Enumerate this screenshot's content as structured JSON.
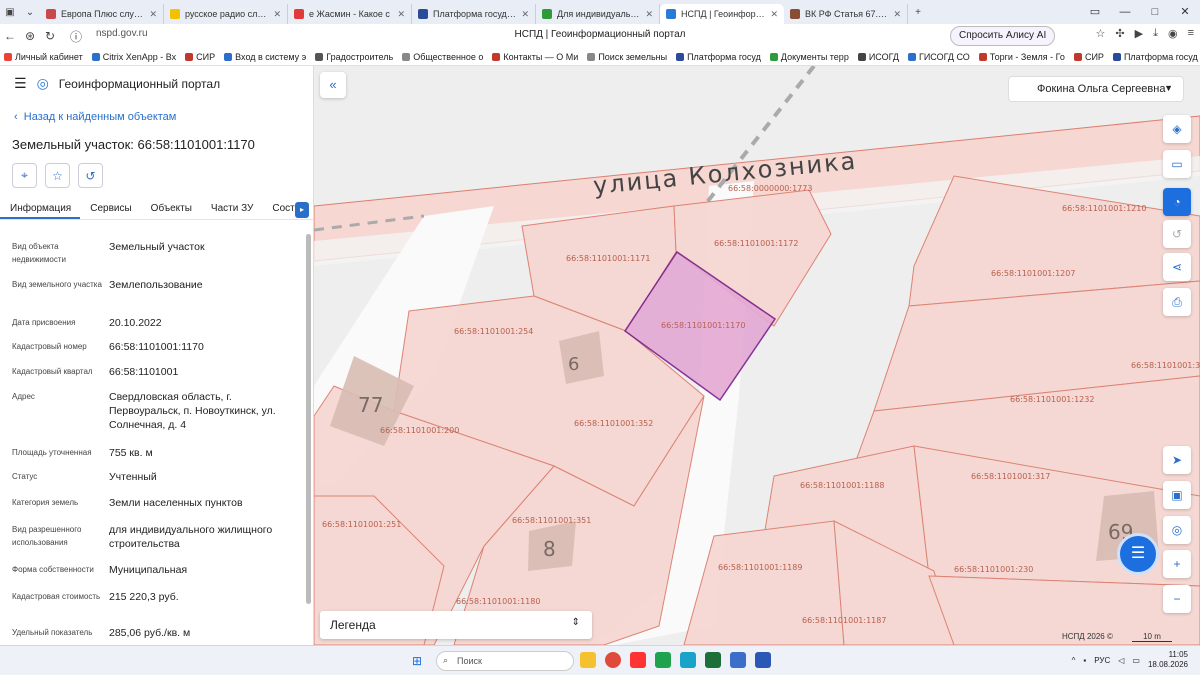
{
  "browser": {
    "tabs": [
      {
        "title": "Европа Плюс слушать он",
        "color": "#c84a4a"
      },
      {
        "title": "русское радио слушать о",
        "color": "#f2c200"
      },
      {
        "title": "е Жасмин - Какое с",
        "color": "#e23a3a"
      },
      {
        "title": "Платформа государстве",
        "color": "#2a4a9a"
      },
      {
        "title": "Для индивидуального жи",
        "color": "#2e9b3a"
      },
      {
        "title": "НСПД | Геоинформацио",
        "color": "#2a7bd8"
      },
      {
        "title": "ВК РФ Статья 67.1. Пред",
        "color": "#8a4c32"
      }
    ],
    "url": "nspd.gov.ru",
    "page_title": "НСПД | Геоинформационный портал",
    "alice_label": "Спросить Алису AI",
    "bookmarks": [
      "Личный кабинет",
      "Citrix XenApp - Вх",
      "СИР",
      "Вход в систему э",
      "Градостроитель",
      "Общественное о",
      "Контакты — О Ми",
      "Поиск земельны",
      "Платформа госуд",
      "Документы терр",
      "ИСОГД",
      "ГИСОГД СО",
      "Торги - Земля - Го",
      "СИР",
      "Платформа госуд"
    ]
  },
  "panel": {
    "app_title": "Геоинформационный портал",
    "back_label": "Назад к найденным объектам",
    "title": "Земельный участок: 66:58:1101001:1170",
    "tabs": [
      "Информация",
      "Сервисы",
      "Объекты",
      "Части ЗУ",
      "Состав"
    ],
    "properties": [
      {
        "label": "Вид объекта недвижимости",
        "value": "Земельный участок"
      },
      {
        "label": "Вид земельного участка",
        "value": "Землепользование"
      },
      {
        "label": "Дата присвоения",
        "value": "20.10.2022"
      },
      {
        "label": "Кадастровый номер",
        "value": "66:58:1101001:1170"
      },
      {
        "label": "Кадастровый квартал",
        "value": "66:58:1101001"
      },
      {
        "label": "Адрес",
        "value": "Свердловская область, г. Первоуральск, п. Новоуткинск, ул. Солнечная, д. 4"
      },
      {
        "label": "Площадь уточненная",
        "value": "755 кв. м"
      },
      {
        "label": "Статус",
        "value": "Учтенный"
      },
      {
        "label": "Категория земель",
        "value": "Земли населенных пунктов"
      },
      {
        "label": "Вид разрешенного использования",
        "value": "для индивидуального жилищного строительства"
      },
      {
        "label": "Форма собственности",
        "value": "Муниципальная"
      },
      {
        "label": "Кадастровая стоимость",
        "value": "215 220,3 руб."
      },
      {
        "label": "Удельный показатель",
        "value": "285,06 руб./кв. м"
      }
    ]
  },
  "map": {
    "user_name": "Фокина Ольга Сергеевна",
    "street_name": "улица Колхозника",
    "legend_label": "Легенда",
    "copyright": "НСПД 2026 ©",
    "scale_label": "10 m",
    "parcels": [
      "66:58:0000000:1773",
      "66:58:1101001:1171",
      "66:58:1101001:1172",
      "66:58:1101001:1170",
      "66:58:1101001:254",
      "66:58:1101001:352",
      "66:58:1101001:200",
      "66:58:1101001:351",
      "66:58:1101001:251",
      "66:58:1101001:1180",
      "66:58:1101001:1210",
      "66:58:1101001:1207",
      "66:58:1101001:1232",
      "66:58:1101001:317",
      "66:58:1101001:1188",
      "66:58:1101001:1189",
      "66:58:1101001:230",
      "66:58:1101001:1187",
      "66:58:1101001:3"
    ],
    "house_numbers": [
      "77",
      "6",
      "8",
      "69"
    ],
    "colors": {
      "parcel_fill": "#f6d7d2",
      "parcel_stroke": "#dc7e6e",
      "selected_fill": "#e4a9d4",
      "selected_stroke": "#7a1f8c"
    }
  },
  "taskbar": {
    "search_placeholder": "Поиск",
    "language": "РУС",
    "time": "11:05",
    "date": "18.08.2026"
  }
}
